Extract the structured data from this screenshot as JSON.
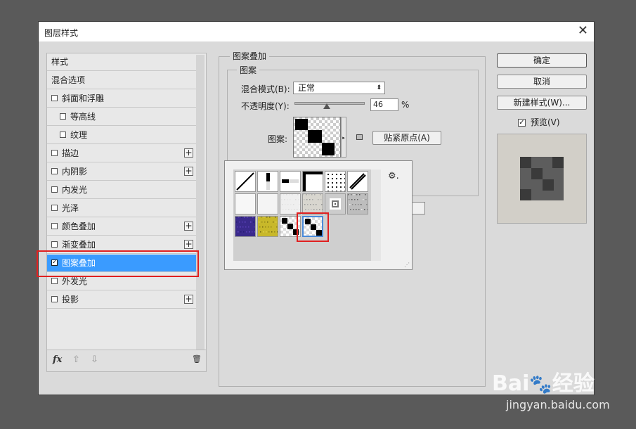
{
  "dialog": {
    "title": "图层样式",
    "close_glyph": "✕"
  },
  "style_list": {
    "items": [
      {
        "label": "样式",
        "checkbox": false,
        "plus": false,
        "indent": 0
      },
      {
        "label": "混合选项",
        "checkbox": false,
        "plus": false,
        "indent": 0
      },
      {
        "label": "斜面和浮雕",
        "checkbox": true,
        "checked": false,
        "plus": false,
        "indent": 0
      },
      {
        "label": "等高线",
        "checkbox": true,
        "checked": false,
        "plus": false,
        "indent": 1
      },
      {
        "label": "纹理",
        "checkbox": true,
        "checked": false,
        "plus": false,
        "indent": 1
      },
      {
        "label": "描边",
        "checkbox": true,
        "checked": false,
        "plus": true,
        "indent": 0
      },
      {
        "label": "内阴影",
        "checkbox": true,
        "checked": false,
        "plus": true,
        "indent": 0
      },
      {
        "label": "内发光",
        "checkbox": true,
        "checked": false,
        "plus": false,
        "indent": 0
      },
      {
        "label": "光泽",
        "checkbox": true,
        "checked": false,
        "plus": false,
        "indent": 0
      },
      {
        "label": "颜色叠加",
        "checkbox": true,
        "checked": false,
        "plus": true,
        "indent": 0
      },
      {
        "label": "渐变叠加",
        "checkbox": true,
        "checked": false,
        "plus": true,
        "indent": 0
      },
      {
        "label": "图案叠加",
        "checkbox": true,
        "checked": true,
        "plus": false,
        "indent": 0,
        "selected": true
      },
      {
        "label": "外发光",
        "checkbox": true,
        "checked": false,
        "plus": false,
        "indent": 0
      },
      {
        "label": "投影",
        "checkbox": true,
        "checked": false,
        "plus": true,
        "indent": 0
      }
    ],
    "plus_glyph": "+",
    "check_glyph": "✓",
    "bottom": {
      "fx": "fx",
      "up": "⇧",
      "down": "⇩",
      "trash": "🗑"
    }
  },
  "pattern_overlay": {
    "group_title": "图案叠加",
    "subgroup_title": "图案",
    "blend_mode_label": "混合模式(B):",
    "blend_mode_value": "正常",
    "opacity_label": "不透明度(Y):",
    "opacity_value": "46",
    "opacity_percent": 46,
    "opacity_unit": "%",
    "pattern_label": "图案:",
    "snap_button": "贴紧原点(A)",
    "select_arrow": "⬍",
    "swatch_arrow": "▸"
  },
  "picker": {
    "gear": "⚙.",
    "resize": "⋰",
    "tiles": [
      "diagonal-lines",
      "vertical-bar",
      "horizontal-bar",
      "black-white-corner",
      "dots",
      "diagonal-stripe",
      "white-1",
      "white-2",
      "light-texture",
      "gray-noise",
      "concentric-squares",
      "gray-marble",
      "purple-texture",
      "yellow-texture",
      "checker-small",
      "checker-selected"
    ]
  },
  "buttons": {
    "ok": "确定",
    "cancel": "取消",
    "new_style": "新建样式(W)...",
    "preview_label": "预览(V)",
    "preview_checked": true
  },
  "watermark": {
    "brand": "Bai",
    "brand_suffix": "经验",
    "url": "jingyan.baidu.com"
  }
}
